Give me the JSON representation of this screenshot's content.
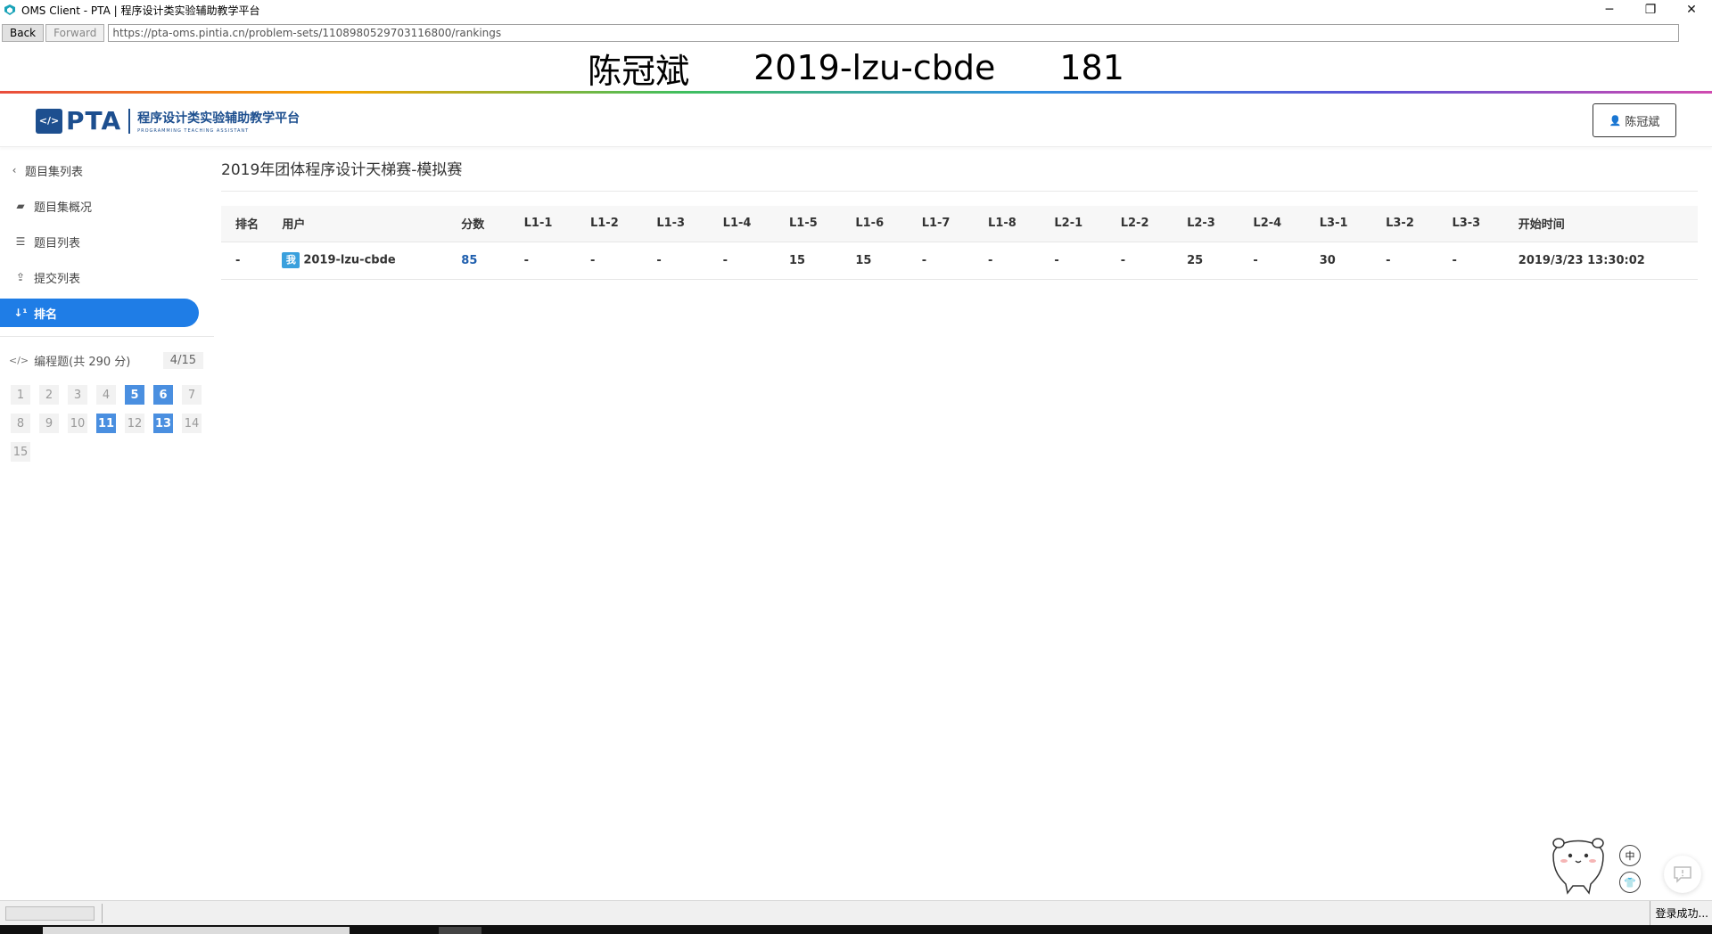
{
  "window": {
    "title": "OMS Client - PTA | 程序设计类实验辅助教学平台",
    "controls": {
      "minimize": "─",
      "restore": "❐",
      "close": "✕"
    }
  },
  "nav": {
    "back_label": "Back",
    "forward_label": "Forward",
    "url": "https://pta-oms.pintia.cn/problem-sets/1108980529703116800/rankings"
  },
  "banner": {
    "name": "陈冠斌",
    "account": "2019-lzu-cbde",
    "number": "181"
  },
  "header": {
    "logo_text": "PTA",
    "logo_title": "程序设计类实验辅助教学平台",
    "logo_subtitle": "PROGRAMMING TEACHING ASSISTANT",
    "user_button": "陈冠斌"
  },
  "sidebar": {
    "back": {
      "label": "题目集列表",
      "icon": "chevron-left-icon"
    },
    "items": [
      {
        "label": "题目集概况",
        "icon": "book-icon",
        "active": false
      },
      {
        "label": "题目列表",
        "icon": "list-icon",
        "active": false
      },
      {
        "label": "提交列表",
        "icon": "upload-icon",
        "active": false
      },
      {
        "label": "排名",
        "icon": "sort-numeric-icon",
        "active": true
      }
    ],
    "problem_section": {
      "label": "编程题(共 290 分)",
      "count": "4/15",
      "cells": [
        {
          "n": "1",
          "done": false
        },
        {
          "n": "2",
          "done": false
        },
        {
          "n": "3",
          "done": false
        },
        {
          "n": "4",
          "done": false
        },
        {
          "n": "5",
          "done": true
        },
        {
          "n": "6",
          "done": true
        },
        {
          "n": "7",
          "done": false
        },
        {
          "n": "8",
          "done": false
        },
        {
          "n": "9",
          "done": false
        },
        {
          "n": "10",
          "done": false
        },
        {
          "n": "11",
          "done": true
        },
        {
          "n": "12",
          "done": false
        },
        {
          "n": "13",
          "done": true
        },
        {
          "n": "14",
          "done": false
        },
        {
          "n": "15",
          "done": false
        }
      ]
    }
  },
  "main": {
    "title": "2019年团体程序设计天梯赛-模拟赛",
    "table": {
      "headers": [
        "排名",
        "用户",
        "分数",
        "L1-1",
        "L1-2",
        "L1-3",
        "L1-4",
        "L1-5",
        "L1-6",
        "L1-7",
        "L1-8",
        "L2-1",
        "L2-2",
        "L2-3",
        "L2-4",
        "L3-1",
        "L3-2",
        "L3-3",
        "开始时间"
      ],
      "rows": [
        {
          "rank": "-",
          "me_badge": "我",
          "user": "2019-lzu-cbde",
          "score": "85",
          "cells": [
            "-",
            "-",
            "-",
            "-",
            "15",
            "15",
            "-",
            "-",
            "-",
            "-",
            "25",
            "-",
            "30",
            "-",
            "-"
          ],
          "start_time": "2019/3/23 13:30:02"
        }
      ]
    }
  },
  "widgets": {
    "lang_button": "中",
    "shirt_button": "👕",
    "feedback_icon": "comment-icon"
  },
  "statusbar": {
    "status_text": "登录成功..."
  },
  "colors": {
    "accent": "#1f7de6",
    "brand": "#1d4f8f",
    "done_cell": "#4a8fe0",
    "score": "#1f5fae"
  }
}
